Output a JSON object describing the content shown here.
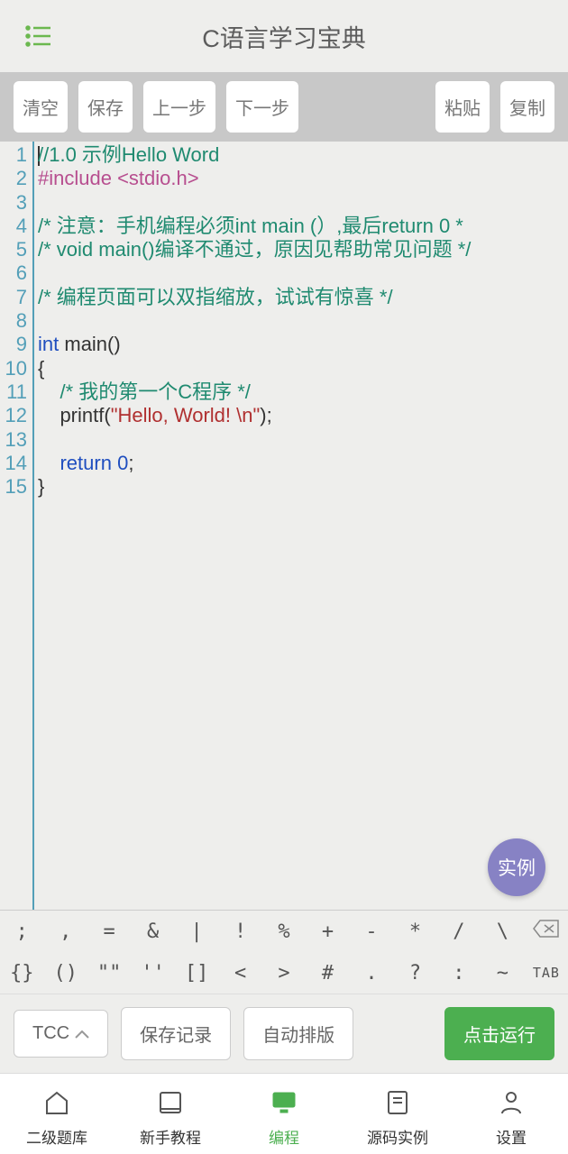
{
  "header": {
    "title": "C语言学习宝典"
  },
  "toolbar": {
    "clear": "清空",
    "save": "保存",
    "undo": "上一步",
    "redo": "下一步",
    "paste": "粘贴",
    "copy": "复制"
  },
  "code": {
    "lines": [
      {
        "n": 1,
        "segments": [
          {
            "t": "//1.0 示例Hello Word",
            "c": "c-comment"
          }
        ]
      },
      {
        "n": 2,
        "segments": [
          {
            "t": "#include <stdio.h>",
            "c": "c-pre"
          }
        ]
      },
      {
        "n": 3,
        "segments": []
      },
      {
        "n": 4,
        "segments": [
          {
            "t": "/* 注意：手机编程必须int main (）,最后return 0 *",
            "c": "c-comment"
          }
        ]
      },
      {
        "n": 5,
        "segments": [
          {
            "t": "/* void main()编译不通过，原因见帮助常见问题 */",
            "c": "c-comment"
          }
        ]
      },
      {
        "n": 6,
        "segments": []
      },
      {
        "n": 7,
        "segments": [
          {
            "t": "/* 编程页面可以双指缩放，试试有惊喜 */",
            "c": "c-comment"
          }
        ]
      },
      {
        "n": 8,
        "segments": []
      },
      {
        "n": 9,
        "segments": [
          {
            "t": "int",
            "c": "c-kw"
          },
          {
            "t": " main()"
          }
        ]
      },
      {
        "n": 10,
        "segments": [
          {
            "t": "{"
          }
        ]
      },
      {
        "n": 11,
        "segments": [
          {
            "t": "    "
          },
          {
            "t": "/* 我的第一个C程序 */",
            "c": "c-comment"
          }
        ]
      },
      {
        "n": 12,
        "segments": [
          {
            "t": "    printf("
          },
          {
            "t": "\"Hello, World! \\n\"",
            "c": "c-str"
          },
          {
            "t": ");"
          }
        ]
      },
      {
        "n": 13,
        "segments": []
      },
      {
        "n": 14,
        "segments": [
          {
            "t": "    "
          },
          {
            "t": "return",
            "c": "c-kw"
          },
          {
            "t": " "
          },
          {
            "t": "0",
            "c": "c-num"
          },
          {
            "t": ";"
          }
        ]
      },
      {
        "n": 15,
        "segments": [
          {
            "t": "}"
          }
        ]
      }
    ]
  },
  "fab": {
    "label": "实例"
  },
  "symbols": {
    "row1": [
      ";",
      ",",
      "=",
      "&",
      "|",
      "!",
      "%",
      "+",
      "-",
      "*",
      "/",
      "\\",
      "⌫"
    ],
    "row2": [
      "{}",
      "()",
      "\"\"",
      "''",
      "[]",
      "<",
      ">",
      "#",
      ".",
      "?",
      ":",
      "~",
      "TAB"
    ]
  },
  "actions": {
    "compiler": "TCC",
    "save_record": "保存记录",
    "format": "自动排版",
    "run": "点击运行"
  },
  "nav": {
    "items": [
      {
        "id": "bank",
        "label": "二级题库"
      },
      {
        "id": "tutorial",
        "label": "新手教程"
      },
      {
        "id": "code",
        "label": "编程",
        "active": true
      },
      {
        "id": "examples",
        "label": "源码实例"
      },
      {
        "id": "settings",
        "label": "设置"
      }
    ]
  }
}
